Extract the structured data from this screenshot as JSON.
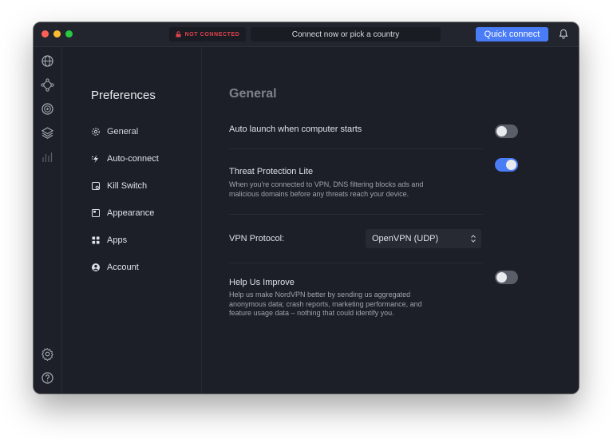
{
  "titlebar": {
    "status": "NOT CONNECTED",
    "search_placeholder": "Connect now or pick a country",
    "quick_connect": "Quick connect"
  },
  "rail": {
    "icons": [
      "globe-icon",
      "meshnet-icon",
      "target-icon",
      "layers-icon",
      "stats-icon",
      "settings-icon",
      "help-icon"
    ]
  },
  "preferences": {
    "title": "Preferences",
    "items": [
      {
        "label": "General",
        "icon": "gear-icon",
        "active": true
      },
      {
        "label": "Auto-connect",
        "icon": "auto-connect-icon"
      },
      {
        "label": "Kill Switch",
        "icon": "kill-switch-icon"
      },
      {
        "label": "Appearance",
        "icon": "appearance-icon"
      },
      {
        "label": "Apps",
        "icon": "apps-icon"
      },
      {
        "label": "Account",
        "icon": "account-icon"
      }
    ]
  },
  "general": {
    "title": "General",
    "auto_launch": {
      "label": "Auto launch when computer starts",
      "enabled": false
    },
    "threat_protection": {
      "label": "Threat Protection Lite",
      "description": "When you're connected to VPN, DNS filtering blocks ads and malicious domains before any threats reach your device.",
      "enabled": true
    },
    "vpn_protocol": {
      "label": "VPN Protocol:",
      "value": "OpenVPN (UDP)"
    },
    "help_improve": {
      "label": "Help Us Improve",
      "description": "Help us make NordVPN better by sending us aggregated anonymous data; crash reports, marketing performance, and feature usage data – nothing that could identify you.",
      "enabled": false
    }
  },
  "colors": {
    "accent": "#4a7cf6",
    "danger": "#e0434c",
    "background": "#1c1f27"
  }
}
